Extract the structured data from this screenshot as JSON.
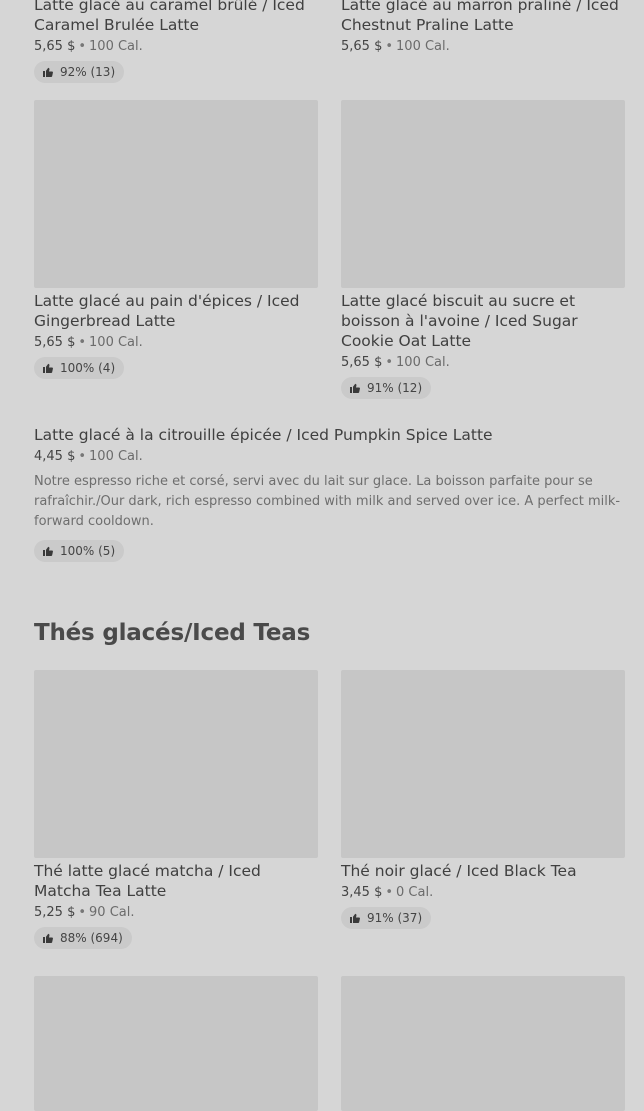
{
  "items": [
    {
      "title": "Latte glacé au caramel brûlé / Iced Caramel Brulée Latte",
      "price": "5,65 $",
      "calories": "100 Cal.",
      "rating": "92% (13)"
    },
    {
      "title": "Latte glacé au marron praliné / Iced Chestnut Praline Latte",
      "price": "5,65 $",
      "calories": "100 Cal.",
      "rating": ""
    },
    {
      "title": "Latte glacé au pain d'épices / Iced Gingerbread Latte",
      "price": "5,65 $",
      "calories": "100 Cal.",
      "rating": "100% (4)"
    },
    {
      "title": "Latte glacé biscuit au sucre et boisson à l'avoine / Iced Sugar Cookie Oat Latte",
      "price": "5,65 $",
      "calories": "100 Cal.",
      "rating": "91% (12)"
    },
    {
      "title": "Latte glacé à la citrouille épicée / Iced Pumpkin Spice Latte",
      "price": "4,45 $",
      "calories": "100 Cal.",
      "description": "Notre espresso riche et corsé, servi avec du lait sur glace. La boisson parfaite pour se rafraîchir./Our dark, rich espresso combined with milk and served over ice. A perfect milk-forward cooldown.",
      "rating": "100% (5)"
    }
  ],
  "section": {
    "title": "Thés glacés/Iced Teas"
  },
  "teas": [
    {
      "title": "Thé latte glacé matcha / Iced Matcha Tea Latte",
      "price": "5,25 $",
      "calories": "90 Cal.",
      "rating": "88% (694)"
    },
    {
      "title": "Thé noir glacé / Iced Black Tea",
      "price": "3,45 $",
      "calories": "0 Cal.",
      "rating": "91% (37)"
    }
  ],
  "separator": "•",
  "icons": {
    "rating": "thumbs-up-icon"
  },
  "colors": {
    "background": "#d6d6d6",
    "image_placeholder": "#c6c6c6",
    "badge": "#cacaca"
  }
}
